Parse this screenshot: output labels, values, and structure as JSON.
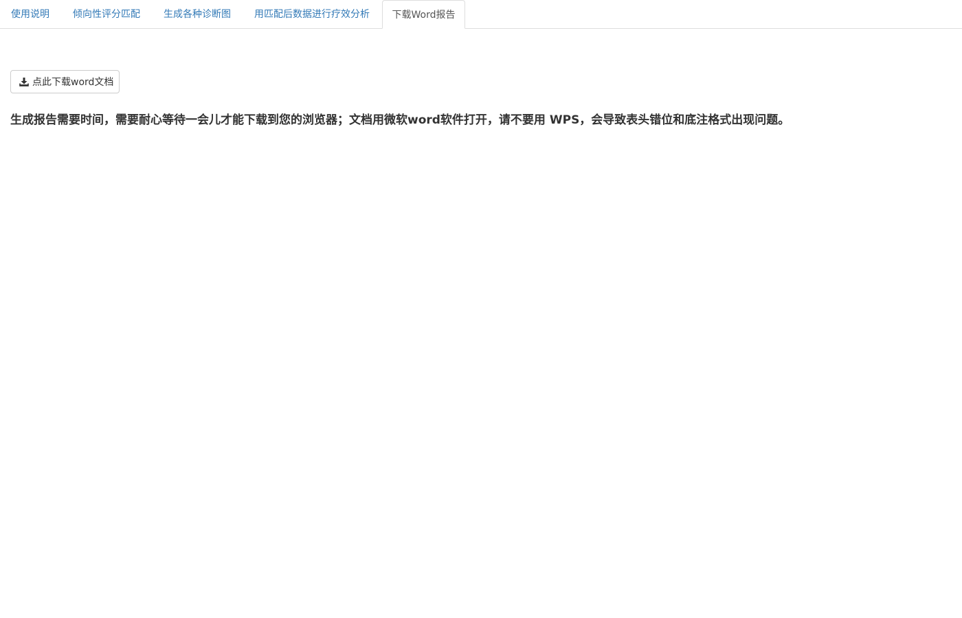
{
  "tabs": [
    {
      "label": "使用说明"
    },
    {
      "label": "倾向性评分匹配"
    },
    {
      "label": "生成各种诊断图"
    },
    {
      "label": "用匹配后数据进行疗效分析"
    },
    {
      "label": "下载Word报告"
    }
  ],
  "active_tab": "下载Word报告",
  "download_button": {
    "label": "点此下载word文档",
    "icon": "download-icon"
  },
  "notice": "生成报告需要时间，需要耐心等待一会儿才能下载到您的浏览器；文档用微软word软件打开，请不要用 WPS，会导致表头错位和底注格式出现问题。",
  "colors": {
    "link": "#337ab7",
    "active_tab_text": "#555555",
    "border": "#dddddd",
    "text": "#333333"
  }
}
